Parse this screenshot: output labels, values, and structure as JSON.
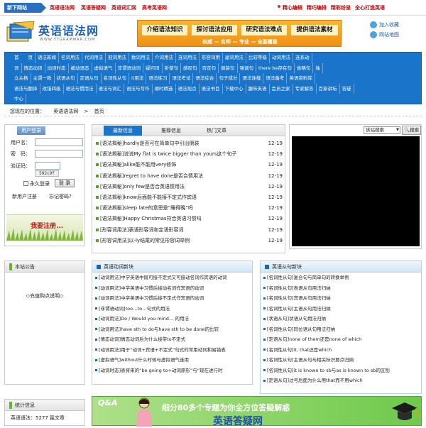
{
  "topbar": {
    "new_site": "新下网站",
    "links_left": [
      "英语语法网",
      "英语答疑网",
      "英语词汇网",
      "高考英语网"
    ],
    "links_right": [
      "精心编辑",
      "精巧编排",
      "精彩纷呈",
      "全心打造英语"
    ]
  },
  "header": {
    "logo_cn": "英语语法网",
    "logo_url": "WWW.YYGRAMMAR.COM",
    "banner_buttons": [
      "介绍语法知识",
      "探讨语法应用",
      "研究语法难点",
      "提供语法素材"
    ],
    "banner_tagline": "权威 — 名师 — 专业 — 全面覆盖",
    "links": [
      "加入收藏",
      "网站地图"
    ]
  },
  "nav": [
    [
      "首　　页",
      "语法新闻",
      "名词用法",
      "代词用法",
      "冠词用法",
      "数词用法",
      "介词用法",
      "连词用法",
      "形容词用",
      "副词用法",
      "比较等级",
      "动词用法",
      "连系动"
    ],
    [
      "词",
      "情态动词",
      "动词时态",
      "被动语态",
      "虚拟语气",
      "非谓语动词",
      "疑问词",
      "祈使句",
      "感叹句",
      "否定句",
      "倒装句",
      "强调句",
      "there be存在句",
      "省略句",
      "独"
    ],
    [
      "立主格",
      "主谓一致",
      "状语从句",
      "定语从句",
      "名词性从句",
      "it用法",
      "语法练习",
      "语法考试",
      "语法综合",
      "句子成分",
      "语法连载",
      "语法备考",
      "英语资料库"
    ],
    [
      "语法与翻译",
      "改错四级",
      "语法与惯用法",
      "语法与词汇",
      "语法与写作",
      "顺时精选",
      "语法视点",
      "语法书目",
      "下载中心",
      "趣味英语",
      "会员之家",
      "专家解答",
      "百家讲坛",
      "答疑"
    ],
    [
      "中心"
    ]
  ],
  "breadcrumb": {
    "prefix": "您现在的位置：",
    "site": "英语语法网",
    "sep": ">",
    "page": "首页"
  },
  "login": {
    "title": "用户登录",
    "user_label": "用户名：",
    "password_label": "密　码：",
    "captcha_label": "验证码：",
    "captcha_code": "592c9f",
    "remember": "永久登录",
    "login_btn": "登 录",
    "register": "新用户注册",
    "forgot": "忘记密码?",
    "promo": "我要注册..."
  },
  "news": {
    "tabs": [
      "最新信息",
      "推荐信息",
      "热门文章"
    ],
    "items": [
      {
        "title": "[语法揭秘]hardly是否可在简单句中引出倒装",
        "date": "12-19"
      },
      {
        "title": "[语法揭秘]说说My  flat  is  twice  bigger  than  yours这个句子",
        "date": "12-19"
      },
      {
        "title": "[语法揭秘]alike能不能用very修饰",
        "date": "12-19"
      },
      {
        "title": "[语法揭秘]regret  to  have  done是否合情用法",
        "date": "12-19"
      },
      {
        "title": "[语法揭秘]only  few是否合英语惯用法",
        "date": "12-19"
      },
      {
        "title": "[语法揭秘]know后面能不能接不定式作宾语",
        "date": "12-19"
      },
      {
        "title": "[语法揭秘]sleep  late的意思是“睡得晚”吗",
        "date": "12-19"
      },
      {
        "title": "[语法揭秘]Happy  Christmas符合英语习惯吗",
        "date": "12-19"
      },
      {
        "title": "[形容词用法]表语形容词和定语形容词",
        "date": "12-19"
      },
      {
        "title": "[形容词用法]以-ly结尾的常见形容词举例",
        "date": "12-19"
      }
    ]
  },
  "search": {
    "select_value": "该站搜索",
    "button": "搜索"
  },
  "notice": {
    "title": "本站公告",
    "text": "◇充值购点说明◇"
  },
  "verbs": {
    "title": "英语动词新块",
    "items": [
      "[动词用法]中学英语中既可接不定式又可接动名词作宾语的动词",
      "[动词用法]中学英语中习惯后接动名词作宾语的动词",
      "[动词用法]中学英语中习惯后接不定式作宾语的动词",
      "[非谓语动词]too…to…句式的用法",
      "[动词用法]Do  /  Would  you  mind…  的用法",
      "[动词用法]have  sth  to  do与have  sth  to  be  done的比较",
      "[情态动词]情态动词后为什么接带to不定式",
      "[动词用法]用于“动词+宾语+不定式”句式的常用动词和易错表",
      "[虚拟语气]without什么时候与虚拟语气连用",
      "[动词时态]表将来的“be  going  to+动词原形”与“现在进行时"
    ]
  },
  "clauses": {
    "title": "英语从句新块",
    "items": [
      "[名词性从句]复合句与简单句的转换举例",
      "[名词性从句]表语从句用法归纳",
      "[名词性从句]宾语从句用法归纳",
      "[名词性从句]主语从句用法归纳",
      "[状语从句]状语从句用法归纳",
      "[名词性从句]同位语从句用法归纳",
      "[定语从句]none  of  them还是none  of  which",
      "[名词性从句]it,  that还是which",
      "[名词性从句]主语从句与相关标识要点归纳",
      "[名词性从句]it  is  known  to  sb与as  is  known  to  sb的区别",
      "[定语从句]过号后面为什么用that而不用which"
    ]
  },
  "stats": {
    "title": "统计信息",
    "line": "英语语法：5277 篇文章"
  },
  "qa_banner": {
    "q": "Q&A",
    "text": "细分80多个专题为你全方位答疑解惑",
    "name": "英语答疑网"
  },
  "colors": {
    "brand_blue": "#1a74c9",
    "accent_orange": "#ef8f12",
    "green": "#6ab42c"
  }
}
